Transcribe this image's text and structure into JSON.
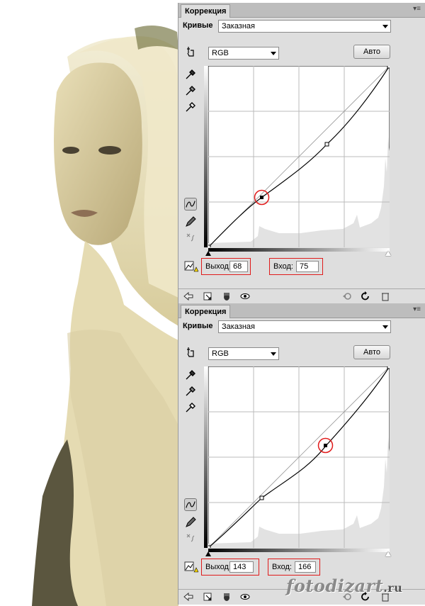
{
  "panels": [
    {
      "tab_title": "Коррекция",
      "preset_label": "Кривые",
      "preset_value": "Заказная",
      "channel": "RGB",
      "auto_label": "Авто",
      "output_label": "Выход:",
      "output_value": "68",
      "input_label": "Вход:",
      "input_value": "75"
    },
    {
      "tab_title": "Коррекция",
      "preset_label": "Кривые",
      "preset_value": "Заказная",
      "channel": "RGB",
      "auto_label": "Авто",
      "output_label": "Выход:",
      "output_value": "143",
      "input_label": "Вход:",
      "input_value": "166"
    }
  ],
  "watermark": {
    "main": "fotodizart",
    "suffix": ".ru"
  },
  "colors": {
    "panel_bg": "#dedede",
    "highlight_box": "#e01b1b",
    "photo_tone": "#c9b98a"
  },
  "icons": [
    "target-adjust-icon",
    "eyedropper-black-icon",
    "eyedropper-gray-icon",
    "eyedropper-white-icon",
    "curve-tool-icon",
    "pencil-tool-icon",
    "smooth-icon",
    "clipping-warning-icon",
    "back-arrow-icon",
    "clip-layer-icon",
    "visibility-icon",
    "eye-icon",
    "view-previous-icon",
    "reset-icon",
    "trash-icon"
  ]
}
